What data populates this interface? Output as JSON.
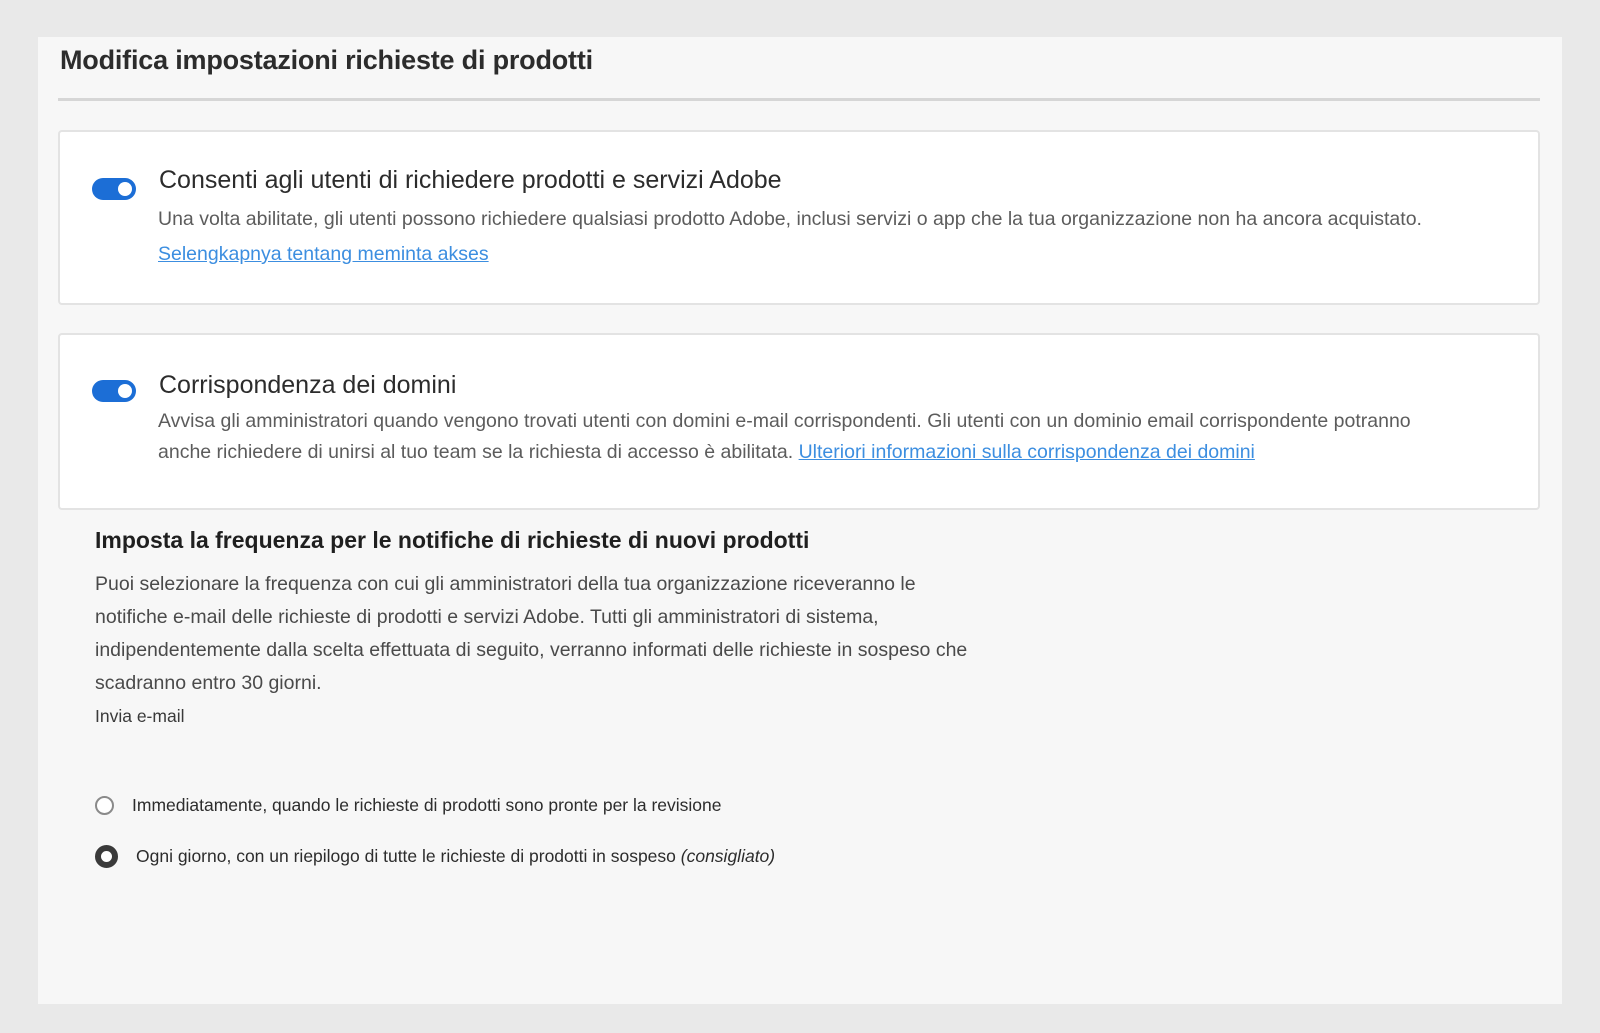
{
  "page": {
    "title": "Modifica impostazioni richieste di prodotti"
  },
  "colors": {
    "toggle_on": "#1c6ed6",
    "link": "#3c8ee0"
  },
  "request_access": {
    "enabled": true,
    "heading": "Consenti agli utenti di richiedere prodotti e servizi Adobe",
    "description": "Una volta abilitate, gli utenti possono richiedere qualsiasi prodotto Adobe, inclusi servizi o app che la tua organizzazione non ha ancora acquistato.",
    "link_label": "Selengkapnya tentang meminta akses"
  },
  "domain_matching": {
    "enabled": true,
    "heading": "Corrispondenza dei domini",
    "description": "Avvisa gli amministratori quando vengono trovati utenti con domini e-mail corrispondenti. Gli utenti con un dominio email corrispondente potranno anche richiedere di unirsi al tuo team se la richiesta di accesso è abilitata.",
    "link_label": "Ulteriori informazioni sulla corrispondenza dei domini"
  },
  "notifications": {
    "title": "Imposta la frequenza per le notifiche di richieste di nuovi prodotti",
    "description": "Puoi selezionare la frequenza con cui gli amministratori della tua organizzazione riceveranno le notifiche e-mail delle richieste di prodotti e servizi Adobe. Tutti gli amministratori di sistema, indipendentemente dalla scelta effettuata di seguito, verranno informati delle richieste in sospeso che scadranno entro 30 giorni.",
    "send_label": "Invia e-mail",
    "options": [
      {
        "label": "Immediatamente, quando le richieste di prodotti sono pronte per la revisione",
        "suffix": "",
        "selected": false
      },
      {
        "label": "Ogni giorno, con un riepilogo di tutte le richieste di prodotti in sospeso ",
        "suffix": "(consigliato)",
        "selected": true
      }
    ]
  }
}
